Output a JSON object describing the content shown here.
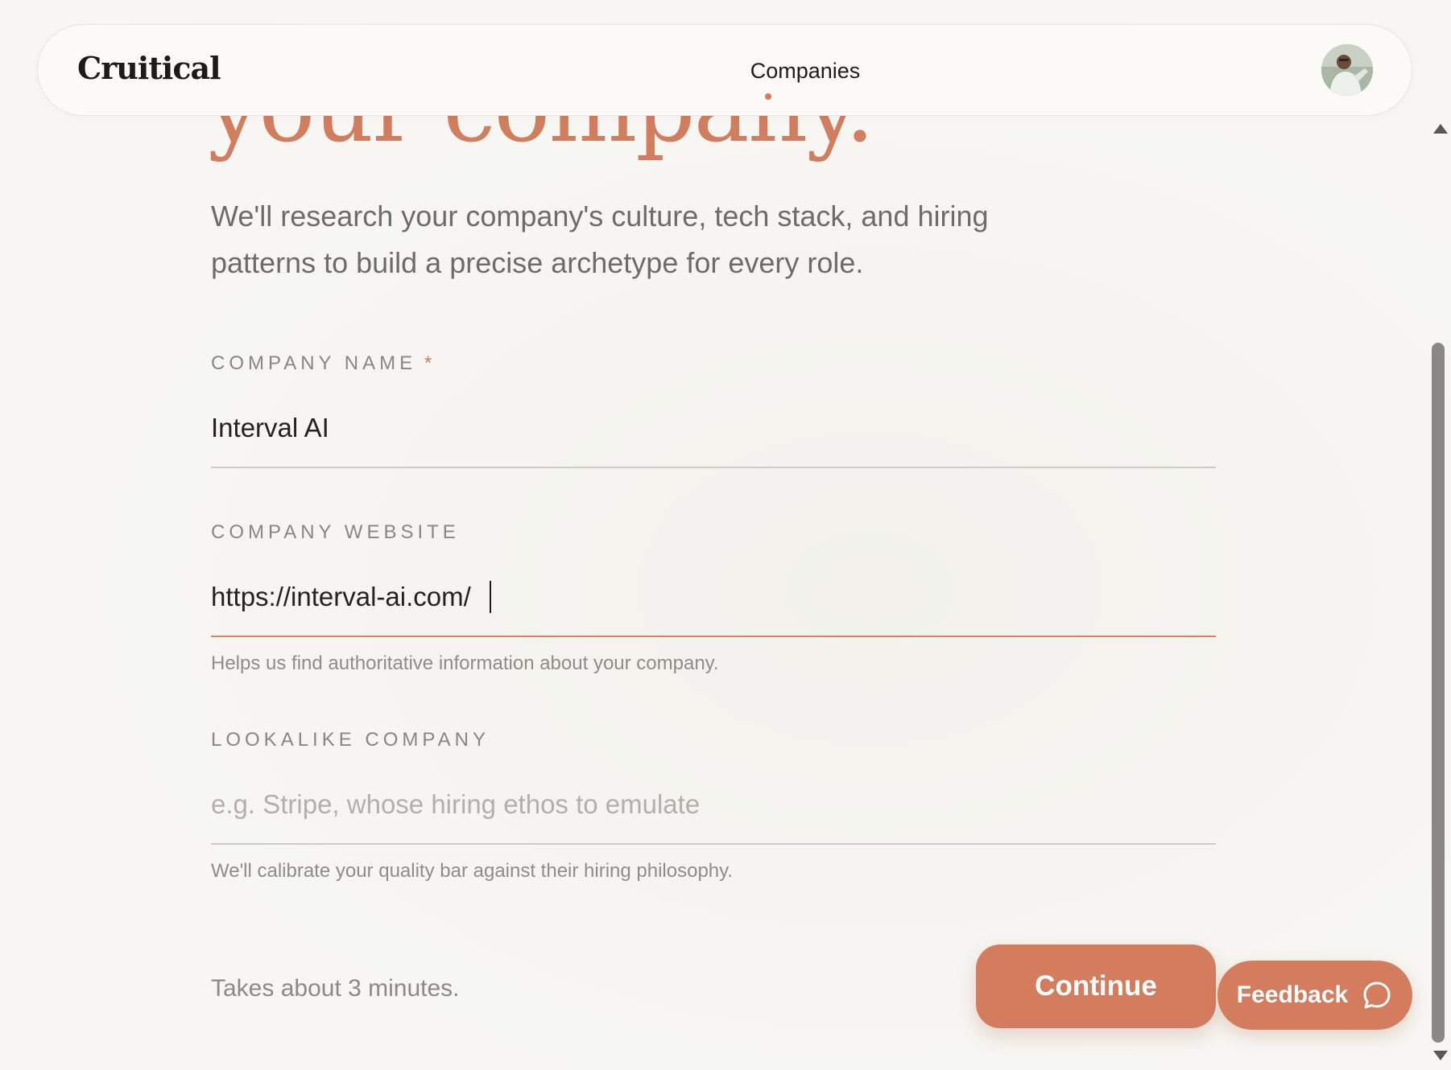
{
  "brand": {
    "logo": "Cruitical",
    "accent_color": "#d17d5e"
  },
  "nav": {
    "active_item": "Companies"
  },
  "user": {
    "avatar_icon": "user-avatar-photo"
  },
  "hero": {
    "headline_fragment": "your company.",
    "subtitle": "We'll research your company's culture, tech stack, and hiring patterns to build a precise archetype for every role."
  },
  "form": {
    "company_name": {
      "label": "COMPANY NAME",
      "required_marker": "*",
      "value": "Interval AI",
      "placeholder": ""
    },
    "company_website": {
      "label": "COMPANY WEBSITE",
      "value": "https://interval-ai.com/",
      "placeholder": "",
      "helper": "Helps us find authoritative information about your company."
    },
    "lookalike_company": {
      "label": "LOOKALIKE COMPANY",
      "value": "",
      "placeholder": "e.g. Stripe, whose hiring ethos to emulate",
      "helper": "We'll calibrate your quality bar against their hiring philosophy."
    }
  },
  "footer": {
    "time_note": "Takes about 3 minutes.",
    "continue_label": "Continue"
  },
  "feedback": {
    "label": "Feedback",
    "icon": "chat-bubble-icon"
  }
}
